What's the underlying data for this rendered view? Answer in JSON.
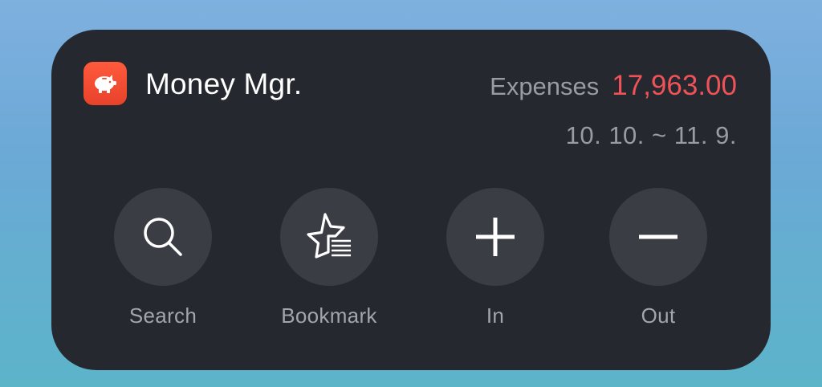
{
  "widget": {
    "app_name": "Money Mgr.",
    "app_icon": "piggy-bank-icon",
    "expenses_label": "Expenses",
    "expenses_value": "17,963.00",
    "period": "10. 10. ~ 11. 9."
  },
  "actions": [
    {
      "label": "Search",
      "icon": "search-icon"
    },
    {
      "label": "Bookmark",
      "icon": "bookmark-star-icon"
    },
    {
      "label": "In",
      "icon": "plus-icon"
    },
    {
      "label": "Out",
      "icon": "minus-icon"
    }
  ],
  "colors": {
    "widget_bg": "#26282f",
    "button_bg": "#3b3d44",
    "expense_value": "#f05357",
    "app_icon": "#ef4a30"
  }
}
